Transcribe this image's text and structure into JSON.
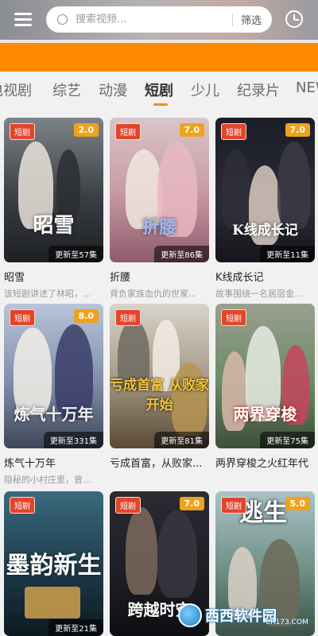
{
  "search": {
    "placeholder": "搜索视频...",
    "filter_label": "筛选"
  },
  "tabs": [
    {
      "label": "电视剧"
    },
    {
      "label": "综艺"
    },
    {
      "label": "动漫"
    },
    {
      "label": "短剧",
      "active": true
    },
    {
      "label": "少儿"
    },
    {
      "label": "纪录片"
    },
    {
      "label": "NEWS"
    }
  ],
  "colors": {
    "accent": "#ff8a00",
    "genre_badge": "#e2452c",
    "score_badge": "#f0a21a"
  },
  "cards": [
    {
      "genre": "短剧",
      "score": "2.0",
      "episodes": "更新至57集",
      "title": "昭雪",
      "desc": "该短剧讲述了林昭，...",
      "art_text": "昭雪"
    },
    {
      "genre": "短剧",
      "score": "7.0",
      "episodes": "更新至86集",
      "title": "折腰",
      "desc": "背负家族血仇的世家...",
      "art_text": "折腰"
    },
    {
      "genre": "短剧",
      "score": "7.0",
      "episodes": "更新至11集",
      "title": "K线成长记",
      "desc": "故事围绕一名居层金...",
      "art_text": "K线成长记"
    },
    {
      "genre": "短剧",
      "score": "8.0",
      "episodes": "更新至331集",
      "title": "炼气十万年",
      "desc": "隐秘的小村庄里，曾...",
      "art_text": "炼气十万年"
    },
    {
      "genre": "短剧",
      "score": "",
      "episodes": "更新至81集",
      "title": "亏成首富，从败家...",
      "desc": "",
      "art_text": "亏成首富 从败家开始"
    },
    {
      "genre": "短剧",
      "score": "",
      "episodes": "更新至75集",
      "title": "两界穿梭之火红年代",
      "desc": "",
      "art_text": "两界穿梭"
    },
    {
      "genre": "短剧",
      "score": "",
      "episodes": "更新至21集",
      "title": "",
      "desc": "",
      "art_text": "墨韵新生"
    },
    {
      "genre": "短剧",
      "score": "7.0",
      "episodes": "",
      "title": "",
      "desc": "",
      "art_text": "跨越时空"
    },
    {
      "genre": "短剧",
      "score": "5.0",
      "episodes": "",
      "title": "",
      "desc": "",
      "art_text": "逃生"
    }
  ],
  "watermark": {
    "name": "西西软件园",
    "url": "CR173.COM"
  }
}
